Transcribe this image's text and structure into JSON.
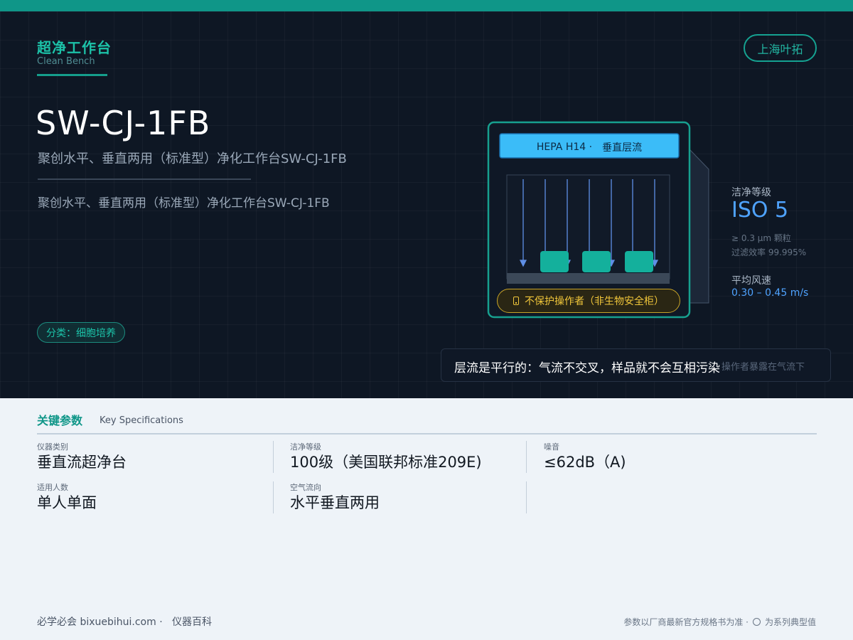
{
  "category": {
    "zh": "超净工作台",
    "en": "Clean Bench"
  },
  "brand": "上海叶拓",
  "product": {
    "model": "SW-CJ-1FB",
    "subtitle": "聚创水平、垂直两用（标准型）净化工作台SW-CJ-1FB",
    "description": "聚创水平、垂直两用（标准型）净化工作台SW-CJ-1FB"
  },
  "tag": "分类：细胞培养",
  "diagram": {
    "filter": "HEPA H14 ·",
    "flow": "垂直层流",
    "warning": "不保护操作者（非生物安全柜）"
  },
  "cleanliness": {
    "label": "洁净等级",
    "value": "ISO 5",
    "particle": "≥ 0.3 μm 颗粒",
    "efficiency": "过滤效率 99.995%"
  },
  "airspeed": {
    "label": "平均风速",
    "value": "0.30 – 0.45 m/s"
  },
  "note": {
    "main": "层流是平行的：气流不交叉，样品就不会互相污染",
    "sub": "操作者暴露在气流下"
  },
  "specs": {
    "title": "关键参数",
    "title_en": "Key Specifications",
    "items": [
      {
        "key": "仪器类别",
        "value": "垂直流超净台"
      },
      {
        "key": "洁净等级",
        "value": "100级（美国联邦标准209E)"
      },
      {
        "key": "噪音",
        "value": "≤62dB（A)"
      },
      {
        "key": "适用人数",
        "value": "单人单面"
      },
      {
        "key": "空气流向",
        "value": "水平垂直两用"
      }
    ]
  },
  "footer": {
    "site": "必学必会 bixuebihui.com ·",
    "section": "仪器百科",
    "disclaimer": "参数以厂商最新官方规格书为准 ·",
    "typical": "为系列典型值"
  },
  "colors": {
    "accent": "#0f9688",
    "hero_bg": "#0e1724",
    "hepa": "#3bbcf8",
    "iso_blue": "#4fa3ff",
    "warning": "#f0c63a",
    "sample": "#14b09c"
  }
}
